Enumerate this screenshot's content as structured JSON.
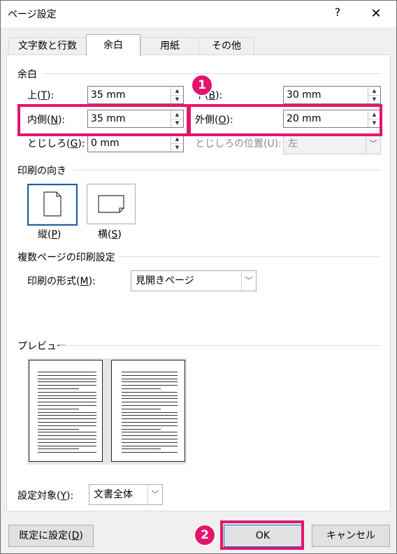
{
  "window": {
    "title": "ページ設定",
    "help": "?",
    "close": "✕"
  },
  "tabs": [
    {
      "label": "文字数と行数"
    },
    {
      "label": "余白"
    },
    {
      "label": "用紙"
    },
    {
      "label": "その他"
    }
  ],
  "margins": {
    "section": "余白",
    "top": {
      "label": "上(",
      "key": "T",
      "end": "):",
      "value": "35 mm"
    },
    "bottom": {
      "label": "下(",
      "key": "B",
      "end": "):",
      "value": "30 mm"
    },
    "inner": {
      "label": "内側(",
      "key": "N",
      "end": "):",
      "value": "35 mm"
    },
    "outer": {
      "label": "外側(",
      "key": "O",
      "end": "):",
      "value": "20 mm"
    },
    "gutter": {
      "label": "とじしろ(",
      "key": "G",
      "end": "):",
      "value": "0 mm"
    },
    "gutter_pos": {
      "label": "とじしろの位置(U):",
      "value": "左"
    }
  },
  "orientation": {
    "section": "印刷の向き",
    "portrait": {
      "label": "縦(",
      "key": "P",
      "end": ")"
    },
    "landscape": {
      "label": "横(",
      "key": "S",
      "end": ")"
    }
  },
  "pages": {
    "section": "複数ページの印刷設定",
    "label": "印刷の形式(",
    "key": "M",
    "end": "):",
    "value": "見開きページ"
  },
  "preview": {
    "section": "プレビュー"
  },
  "apply": {
    "label": "設定対象(",
    "key": "Y",
    "end": "):",
    "value": "文書全体"
  },
  "buttons": {
    "default": "既定に設定(",
    "default_key": "D",
    "default_end": ")",
    "ok": "OK",
    "cancel": "キャンセル"
  },
  "annotations": {
    "badge1": "1",
    "badge2": "2",
    "color": "#e4146c"
  }
}
